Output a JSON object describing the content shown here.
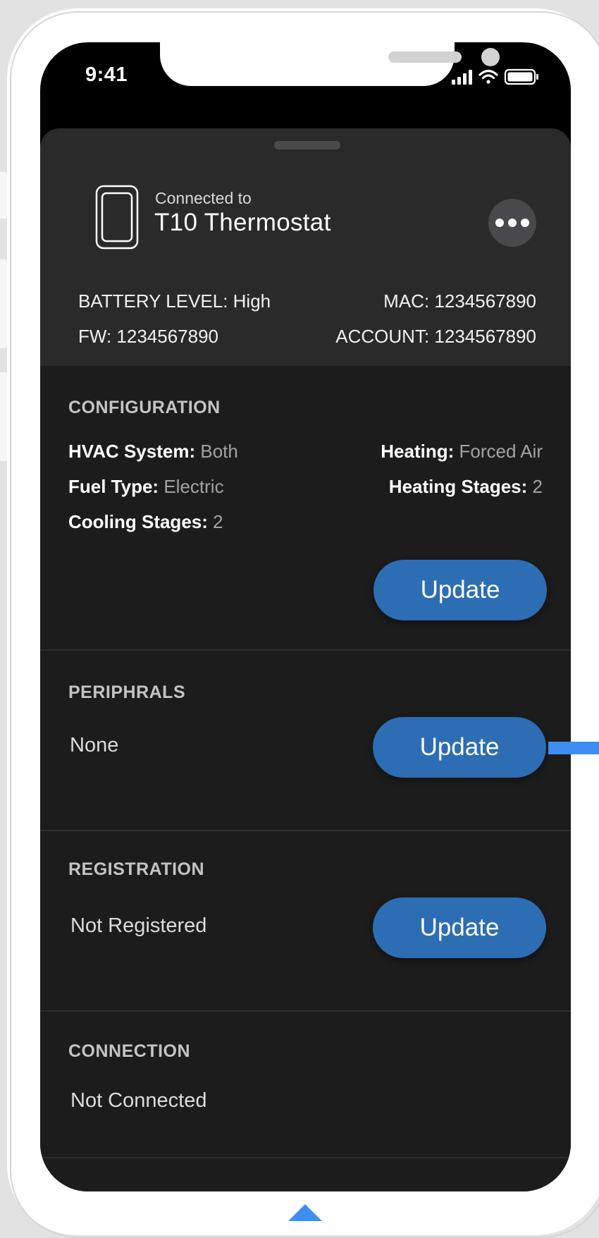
{
  "status_bar": {
    "time": "9:41"
  },
  "device": {
    "connected_label": "Connected to",
    "name": "T10 Thermostat"
  },
  "info": {
    "battery": "BATTERY LEVEL: High",
    "mac": "MAC: 1234567890",
    "fw": "FW: 1234567890",
    "account": "ACCOUNT: 1234567890"
  },
  "configuration": {
    "title": "CONFIGURATION",
    "hvac_label": "HVAC System:",
    "hvac_value": "Both",
    "heating_label": "Heating:",
    "heating_value": "Forced Air",
    "fuel_label": "Fuel Type:",
    "fuel_value": "Electric",
    "heating_stages_label": "Heating Stages:",
    "heating_stages_value": "2",
    "cooling_stages_label": "Cooling Stages:",
    "cooling_stages_value": "2",
    "button": "Update"
  },
  "peripherals": {
    "title": "PERIPHRALS",
    "value": "None",
    "button": "Update"
  },
  "registration": {
    "title": "REGISTRATION",
    "value": "Not Registered",
    "button": "Update"
  },
  "connection": {
    "title": "CONNECTION",
    "value": "Not Connected"
  },
  "colors": {
    "accent": "#2d6db4",
    "annotation": "#3d8ef0",
    "sheet_bg": "#1c1c1d",
    "header_bg": "#2a2a2b"
  }
}
